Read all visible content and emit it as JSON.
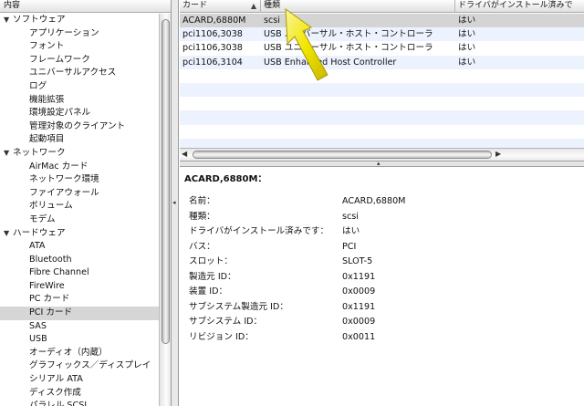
{
  "sidebar": {
    "header": "内容",
    "tree": [
      {
        "kind": "cat",
        "label": "ソフトウェア"
      },
      {
        "kind": "item",
        "label": "アプリケーション"
      },
      {
        "kind": "item",
        "label": "フォント"
      },
      {
        "kind": "item",
        "label": "フレームワーク"
      },
      {
        "kind": "item",
        "label": "ユニバーサルアクセス"
      },
      {
        "kind": "item",
        "label": "ログ"
      },
      {
        "kind": "item",
        "label": "機能拡張"
      },
      {
        "kind": "item",
        "label": "環境設定パネル"
      },
      {
        "kind": "item",
        "label": "管理対象のクライアント"
      },
      {
        "kind": "item",
        "label": "起動項目"
      },
      {
        "kind": "cat",
        "label": "ネットワーク"
      },
      {
        "kind": "item",
        "label": "AirMac カード"
      },
      {
        "kind": "item",
        "label": "ネットワーク環境"
      },
      {
        "kind": "item",
        "label": "ファイアウォール"
      },
      {
        "kind": "item",
        "label": "ボリューム"
      },
      {
        "kind": "item",
        "label": "モデム"
      },
      {
        "kind": "cat",
        "label": "ハードウェア"
      },
      {
        "kind": "item",
        "label": "ATA"
      },
      {
        "kind": "item",
        "label": "Bluetooth"
      },
      {
        "kind": "item",
        "label": "Fibre Channel"
      },
      {
        "kind": "item",
        "label": "FireWire"
      },
      {
        "kind": "item",
        "label": "PC カード"
      },
      {
        "kind": "item",
        "label": "PCI カード",
        "selected": true
      },
      {
        "kind": "item",
        "label": "SAS"
      },
      {
        "kind": "item",
        "label": "USB"
      },
      {
        "kind": "item",
        "label": "オーディオ（内蔵）"
      },
      {
        "kind": "item",
        "label": "グラフィックス／ディスプレイ"
      },
      {
        "kind": "item",
        "label": "シリアル ATA"
      },
      {
        "kind": "item",
        "label": "ディスク作成"
      },
      {
        "kind": "item",
        "label": "パラレル SCSI"
      }
    ]
  },
  "table": {
    "columns": [
      "カード",
      "種類",
      "ドライバがインストール済みで"
    ],
    "rows": [
      {
        "card": "ACARD,6880M",
        "type": "scsi",
        "driver": "はい",
        "selected": true
      },
      {
        "card": "pci1106,3038",
        "type": "USB ユニバーサル・ホスト・コントローラ",
        "driver": "はい"
      },
      {
        "card": "pci1106,3038",
        "type": "USB ユニバーサル・ホスト・コントローラ",
        "driver": "はい"
      },
      {
        "card": "pci1106,3104",
        "type": "USB Enhanced Host Controller",
        "driver": "はい"
      }
    ],
    "empty_rows": 6
  },
  "detail": {
    "title": "ACARD,6880M：",
    "fields": [
      {
        "label": "名前：",
        "value": "ACARD,6880M"
      },
      {
        "label": "種類：",
        "value": "scsi"
      },
      {
        "label": "ドライバがインストール済みです：",
        "value": "はい"
      },
      {
        "label": "バス：",
        "value": "PCI"
      },
      {
        "label": "スロット：",
        "value": "SLOT-5"
      },
      {
        "label": "製造元 ID：",
        "value": "0x1191"
      },
      {
        "label": "装置 ID：",
        "value": "0x0009"
      },
      {
        "label": "サブシステム製造元 ID：",
        "value": "0x1191"
      },
      {
        "label": "サブシステム ID：",
        "value": "0x0009"
      },
      {
        "label": "リビジョン ID：",
        "value": "0x0011"
      }
    ]
  },
  "icons": {
    "expanded": "triangle-down-icon",
    "sort": "sort-up-icon",
    "pointer": "yellow-arrow-annotation"
  },
  "colors": {
    "selection": "#d4d4d4",
    "stripe": "#edf3fe",
    "pointer": "#f2e600"
  }
}
